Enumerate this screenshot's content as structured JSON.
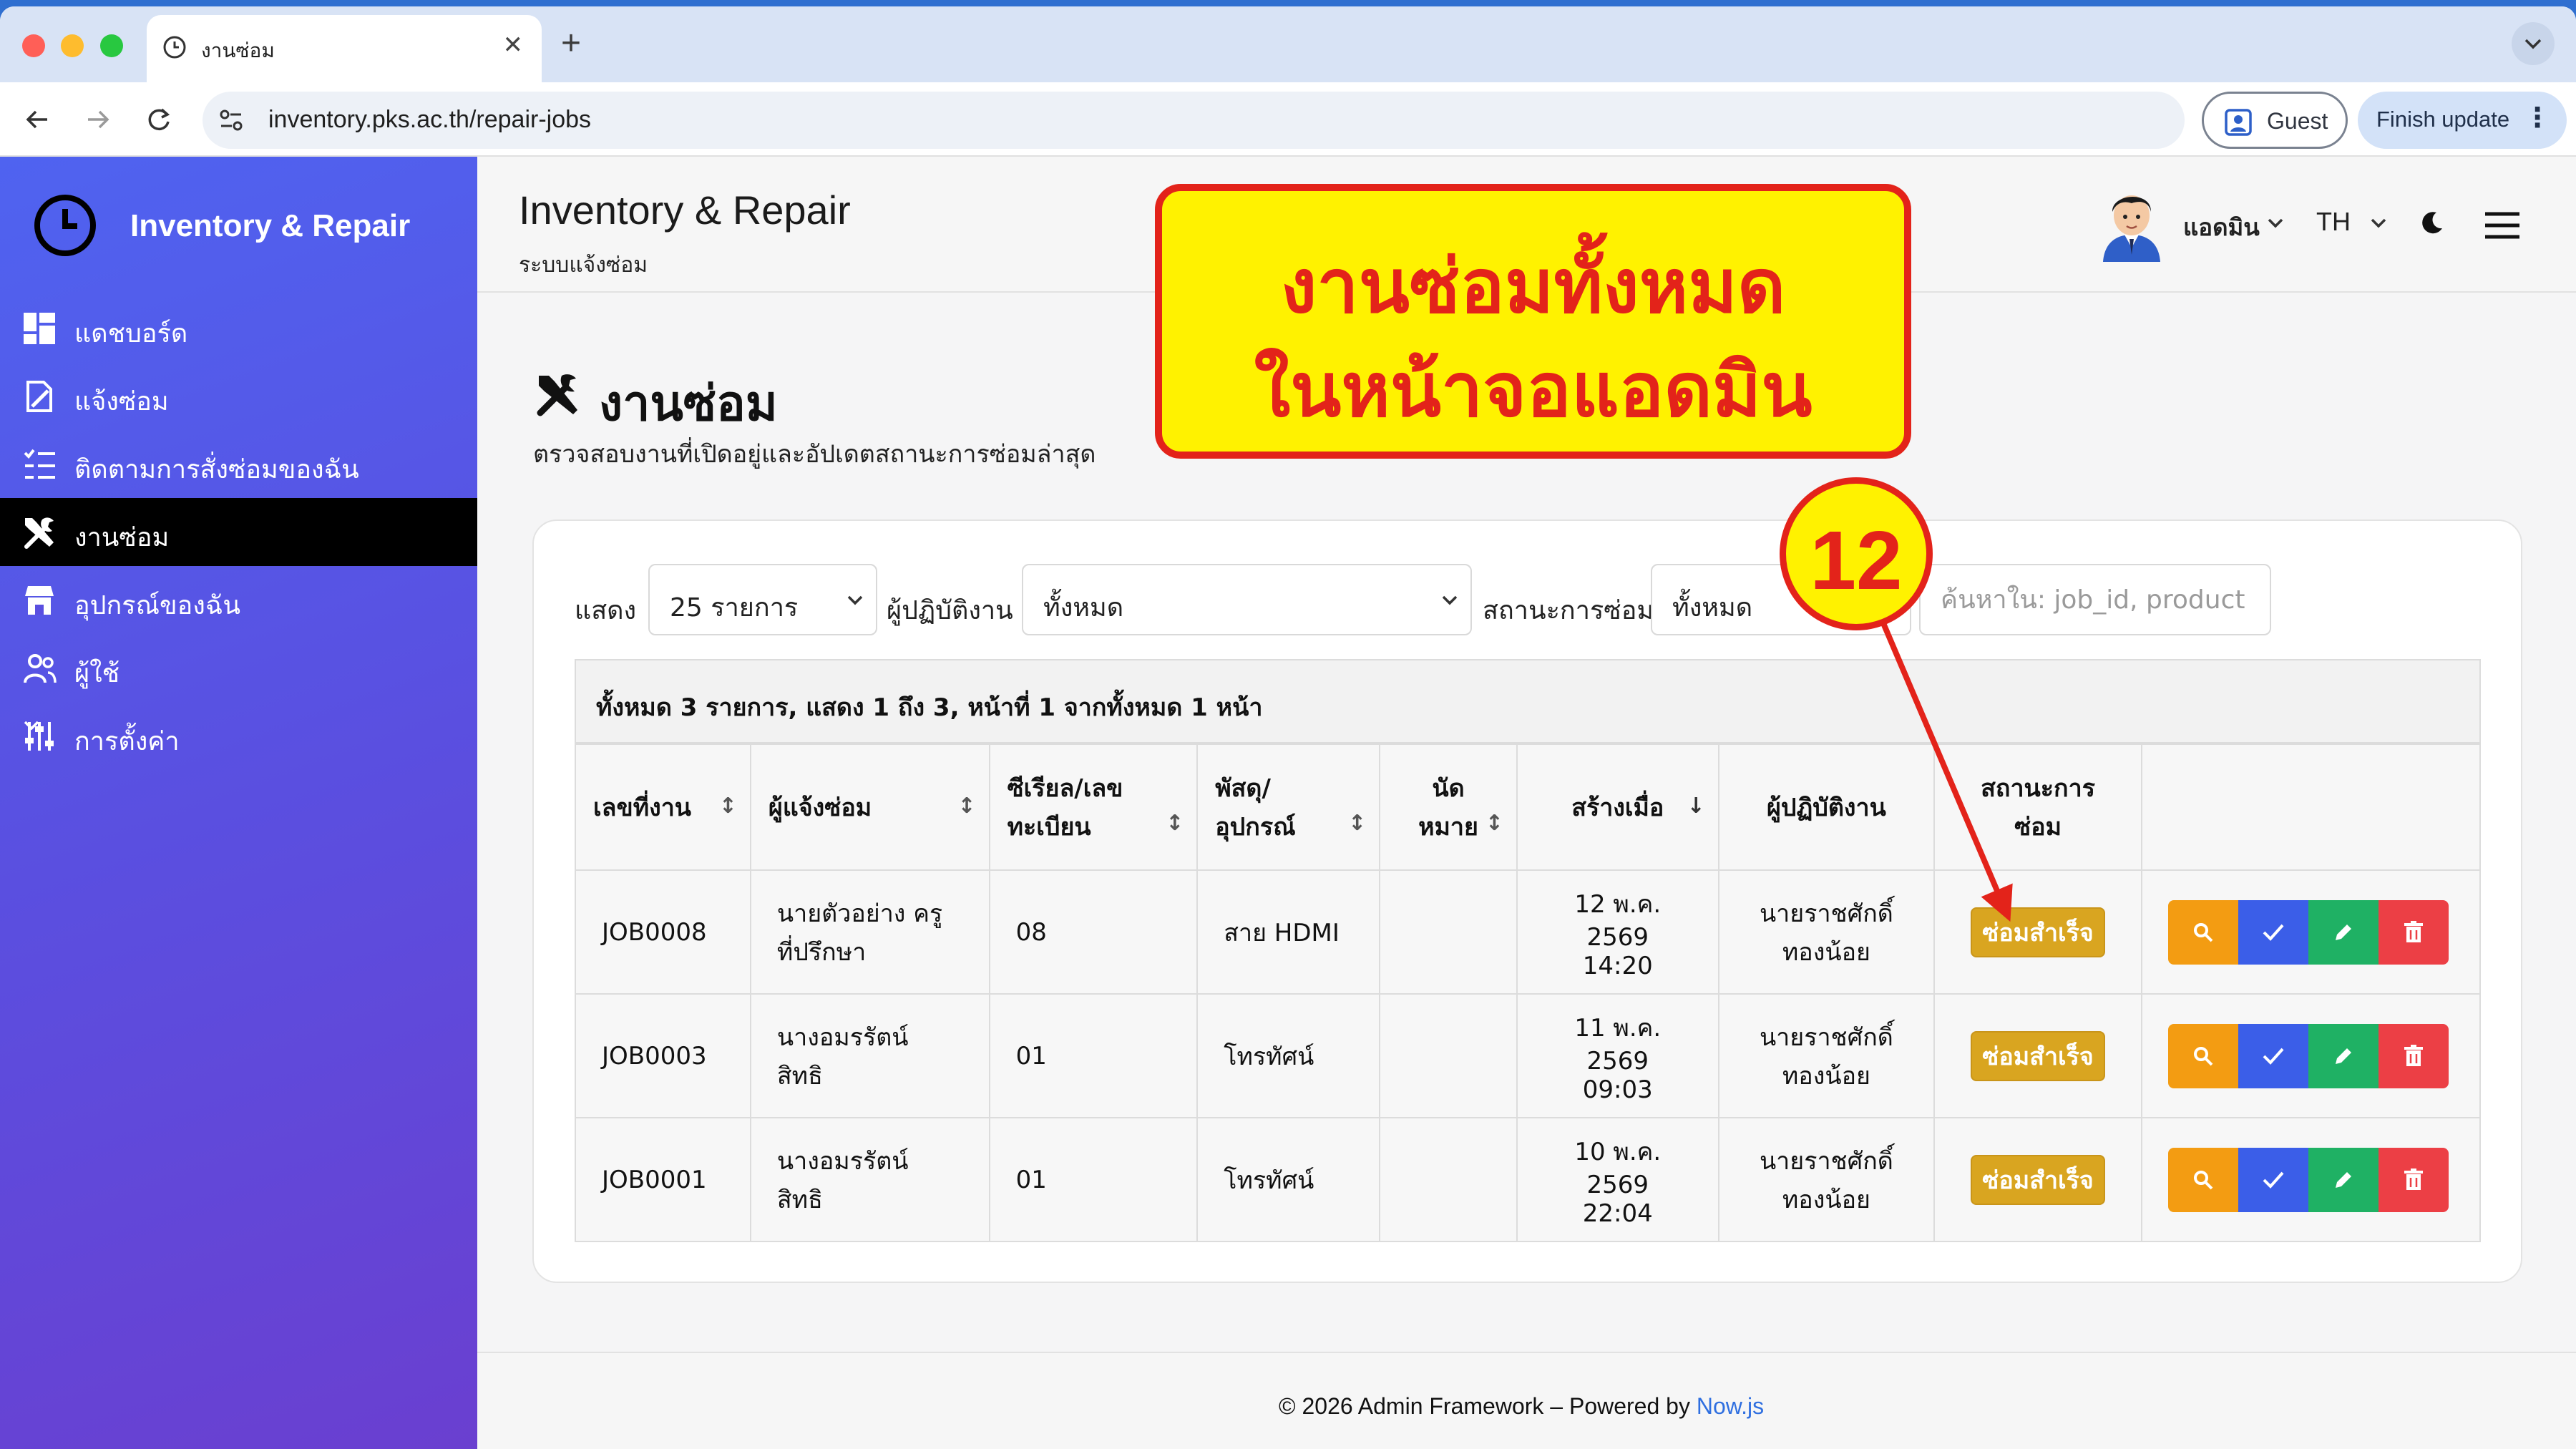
{
  "browser": {
    "tab_title": "งานซ่อม",
    "url": "inventory.pks.ac.th/repair-jobs",
    "guest_label": "Guest",
    "update_label": "Finish update"
  },
  "sidebar": {
    "brand": "Inventory & Repair",
    "items": [
      {
        "label": "แดชบอร์ด",
        "icon": "dashboard-icon"
      },
      {
        "label": "แจ้งซ่อม",
        "icon": "report-icon"
      },
      {
        "label": "ติดตามการสั่งซ่อมของฉัน",
        "icon": "checklist-icon"
      },
      {
        "label": "งานซ่อม",
        "icon": "tools-icon",
        "active": true
      },
      {
        "label": "อุปกรณ์ของฉัน",
        "icon": "store-icon"
      },
      {
        "label": "ผู้ใช้",
        "icon": "users-icon"
      },
      {
        "label": "การตั้งค่า",
        "icon": "sliders-icon"
      }
    ]
  },
  "header": {
    "title": "Inventory & Repair",
    "subtitle": "ระบบแจ้งซ่อม",
    "user": "แอดมิน",
    "lang": "TH"
  },
  "page": {
    "heading": "งานซ่อม",
    "description": "ตรวจสอบงานที่เปิดอยู่และอัปเดตสถานะการซ่อมล่าสุด"
  },
  "filters": {
    "show_label": "แสดง",
    "show_value": "25 รายการ",
    "assignee_label": "ผู้ปฏิบัติงาน",
    "assignee_value": "ทั้งหมด",
    "status_label": "สถานะการซ่อม",
    "status_value": "ทั้งหมด",
    "search_placeholder": "ค้นหาใน: job_id, product"
  },
  "table": {
    "info": "ทั้งหมด 3 รายการ, แสดง 1 ถึง 3, หน้าที่ 1 จากทั้งหมด 1 หน้า",
    "headers": {
      "job_no": "เลขที่งาน",
      "reporter": "ผู้แจ้งซ่อม",
      "serial_1": "ซีเรียล/เลข",
      "serial_2": "ทะเบียน",
      "item_1": "พัสดุ/",
      "item_2": "อุปกรณ์",
      "appt_1": "นัด",
      "appt_2": "หมาย",
      "created": "สร้างเมื่อ",
      "assignee": "ผู้ปฏิบัติงาน",
      "status_1": "สถานะการ",
      "status_2": "ซ่อม"
    },
    "rows": [
      {
        "job": "JOB0008",
        "reporter_1": "นายตัวอย่าง ครู",
        "reporter_2": "ที่ปรึกษา",
        "serial": "08",
        "item": "สาย HDMI",
        "appt": "",
        "date": "12 พ.ค. 2569",
        "time": "14:20",
        "assignee_1": "นายราชศักดิ์",
        "assignee_2": "ทองน้อย",
        "status": "ซ่อมสำเร็จ"
      },
      {
        "job": "JOB0003",
        "reporter_1": "นางอมรรัตน์",
        "reporter_2": "สิทธิ",
        "serial": "01",
        "item": "โทรทัศน์",
        "appt": "",
        "date": "11 พ.ค. 2569",
        "time": "09:03",
        "assignee_1": "นายราชศักดิ์",
        "assignee_2": "ทองน้อย",
        "status": "ซ่อมสำเร็จ"
      },
      {
        "job": "JOB0001",
        "reporter_1": "นางอมรรัตน์",
        "reporter_2": "สิทธิ",
        "serial": "01",
        "item": "โทรทัศน์",
        "appt": "",
        "date": "10 พ.ค. 2569",
        "time": "22:04",
        "assignee_1": "นายราชศักดิ์",
        "assignee_2": "ทองน้อย",
        "status": "ซ่อมสำเร็จ"
      }
    ]
  },
  "footer": {
    "text": "© 2026 Admin Framework – Powered by ",
    "link": "Now.js"
  },
  "annotation": {
    "callout_line1": "งานซ่อมทั้งหมด",
    "callout_line2": "ในหน้าจอแอดมิน",
    "step": "12"
  },
  "colors": {
    "sidebar_gradient_start": "#4f63f0",
    "sidebar_gradient_end": "#6a3fd0",
    "badge_success": "#d9a520",
    "btn_view": "#f39c12",
    "btn_done": "#3b5ee8",
    "btn_edit": "#1fb164",
    "btn_delete": "#ec3f45",
    "callout_fill": "#fff200",
    "callout_stroke": "#e3231a"
  }
}
